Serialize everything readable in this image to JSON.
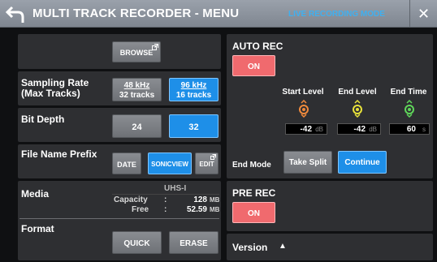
{
  "header": {
    "title": "MULTI TRACK RECORDER - MENU",
    "mode": "LIVE RECORDING MODE",
    "close_glyph": "✕"
  },
  "browse": {
    "label": "BROWSE"
  },
  "sampling": {
    "label_line1": "Sampling Rate",
    "label_line2": "(Max Tracks)",
    "options": [
      {
        "rate": "48 kHz",
        "tracks": "32 tracks",
        "selected": false
      },
      {
        "rate": "96 kHz",
        "tracks": "16 tracks",
        "selected": true
      }
    ]
  },
  "bitdepth": {
    "label": "Bit Depth",
    "options": [
      {
        "label": "24",
        "selected": false
      },
      {
        "label": "32",
        "selected": true
      }
    ]
  },
  "prefix": {
    "label": "File Name Prefix",
    "date": "DATE",
    "sonicview": "SONICVIEW",
    "edit": "EDIT"
  },
  "media": {
    "label": "Media",
    "type": "UHS-I",
    "capacity_label": "Capacity",
    "capacity_value": "128",
    "capacity_unit": "MB",
    "free_label": "Free",
    "free_value": "52.59",
    "free_unit": "MB",
    "colon": ":"
  },
  "format": {
    "label": "Format",
    "quick": "QUICK",
    "erase": "ERASE"
  },
  "autorec": {
    "label": "AUTO REC",
    "on": "ON",
    "start_level_label": "Start Level",
    "end_level_label": "End Level",
    "end_time_label": "End Time",
    "start_level_value": "-42",
    "start_level_unit": "dB",
    "end_level_value": "-42",
    "end_level_unit": "dB",
    "end_time_value": "60",
    "end_time_unit": "s",
    "end_mode_label": "End Mode",
    "take_split": "Take Split",
    "continue": "Continue",
    "colors": {
      "start": "#f08a3c",
      "end": "#e8e23a",
      "time": "#5fd65a"
    }
  },
  "prerec": {
    "label": "PRE REC",
    "on": "ON"
  },
  "version": {
    "label": "Version",
    "arrow": "▲"
  }
}
